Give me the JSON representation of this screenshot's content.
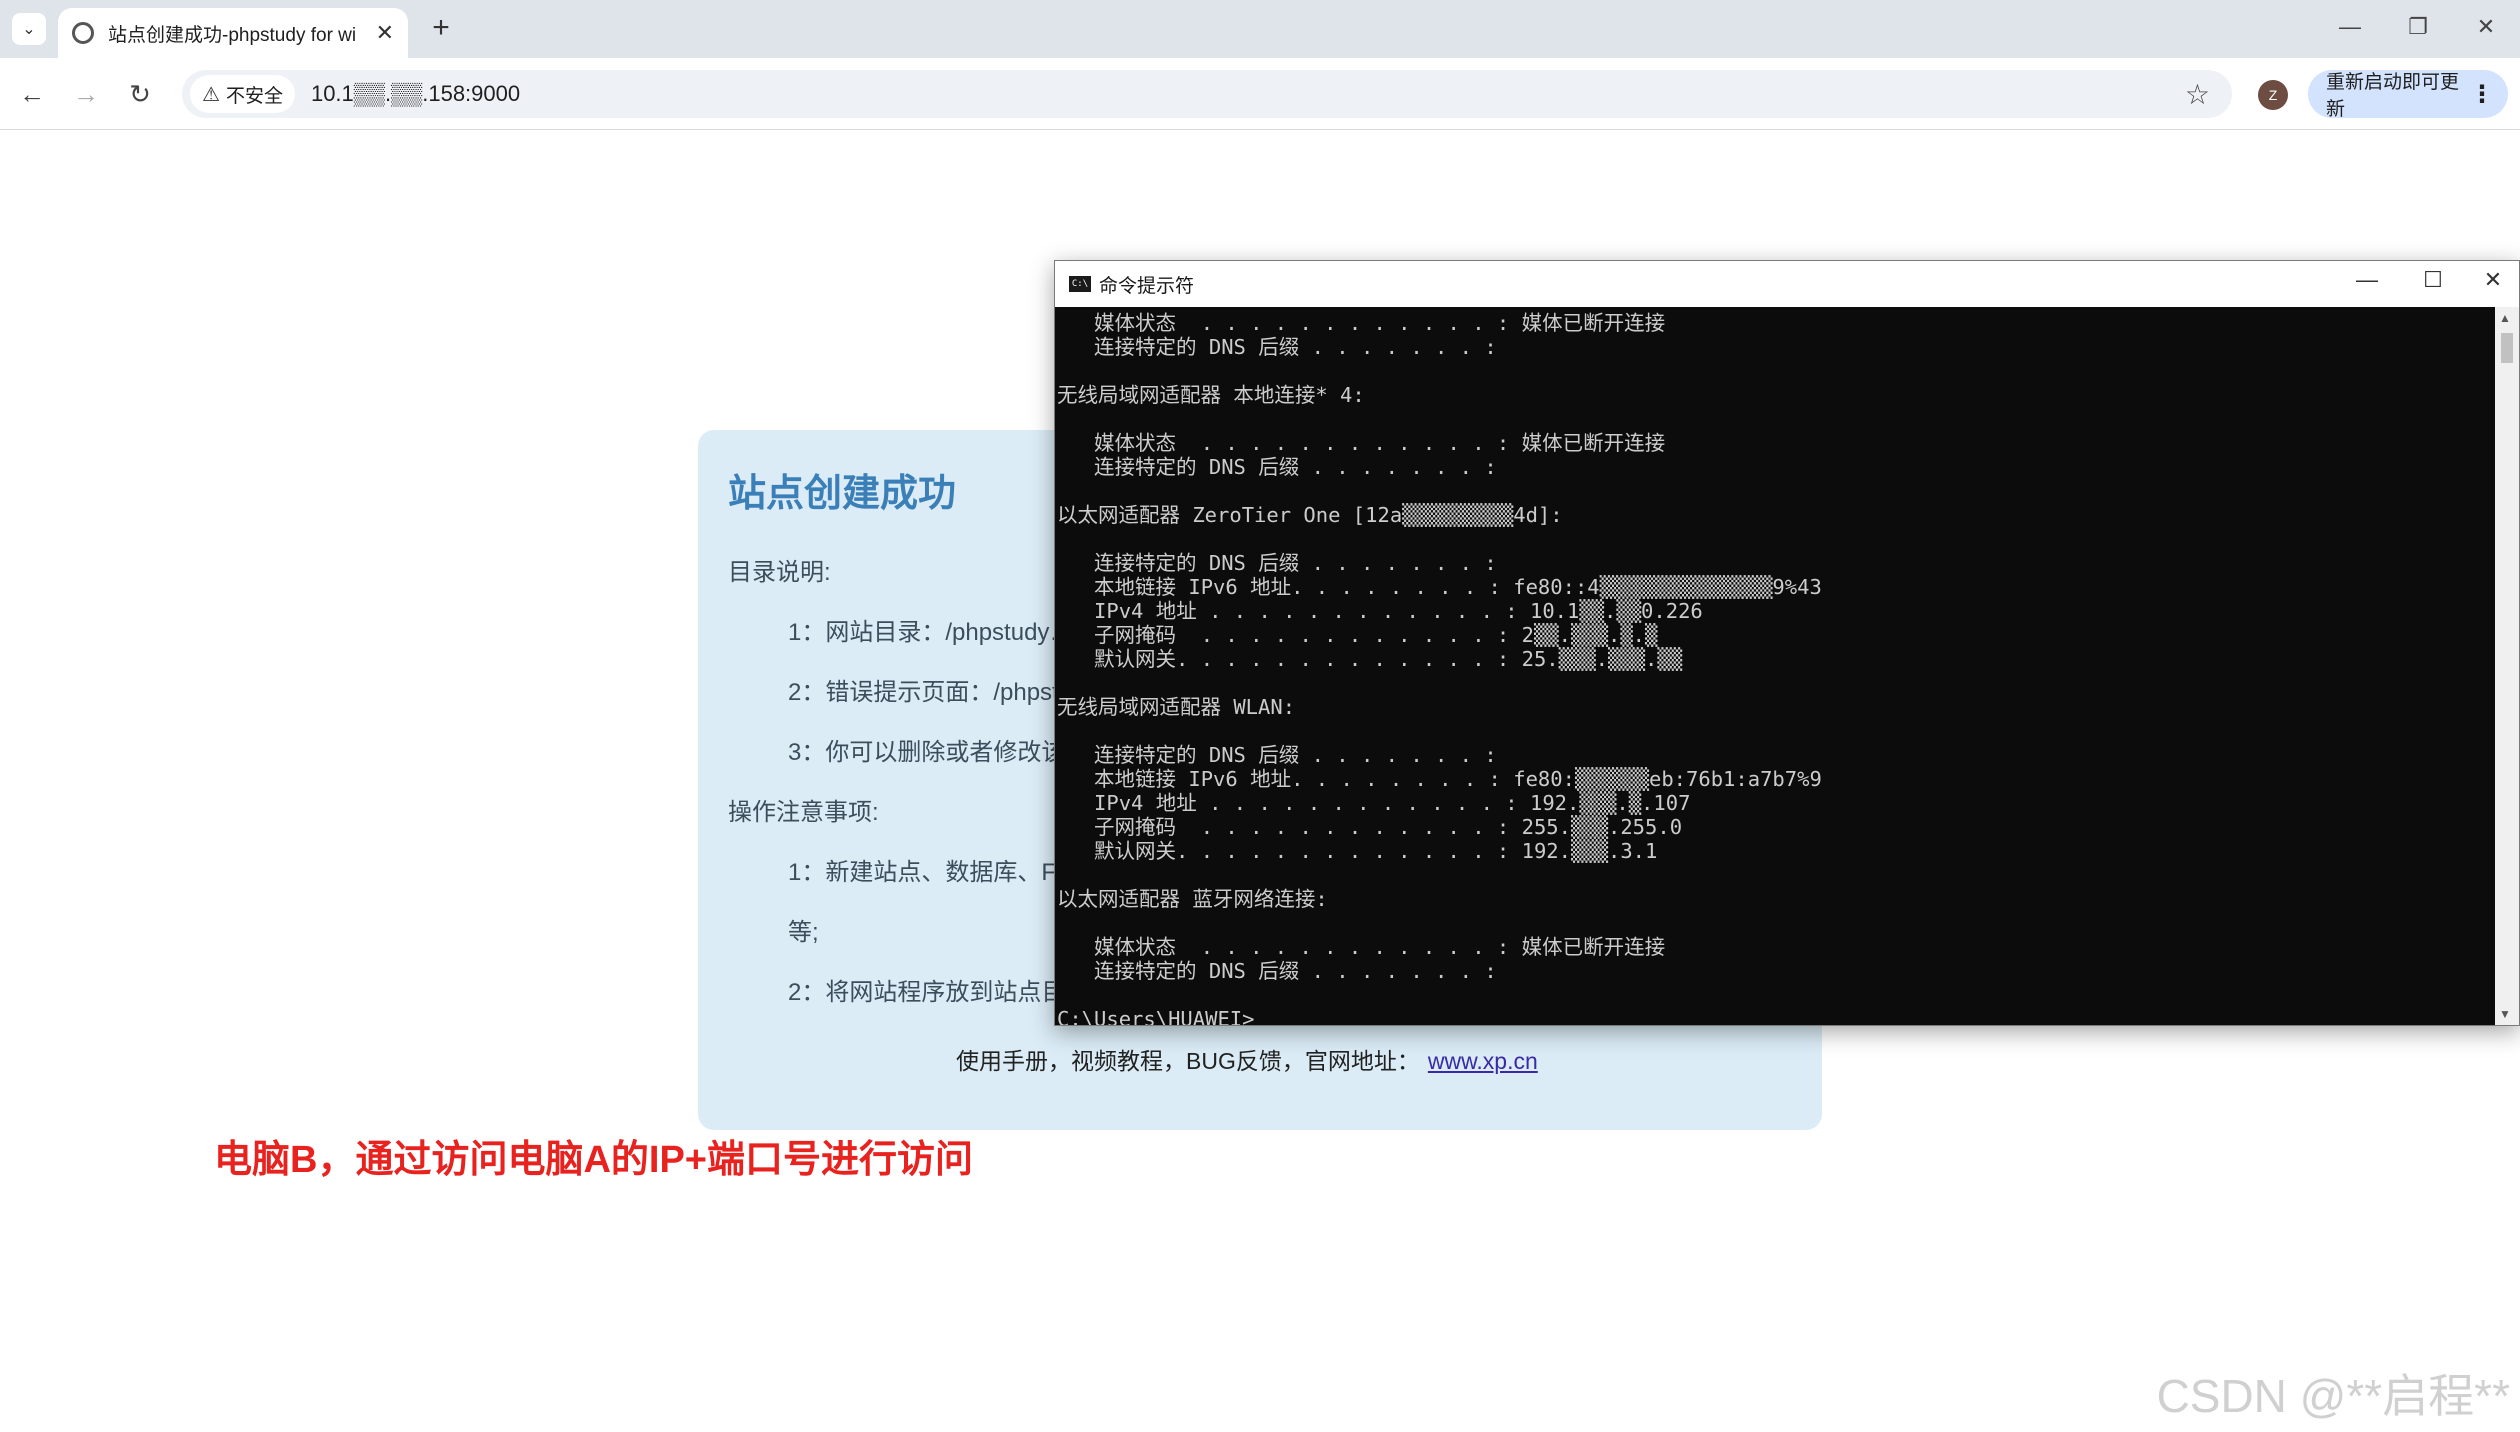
{
  "browser": {
    "tab_title": "站点创建成功-phpstudy for wi",
    "address": "10.1▒▒.▒▒.158:9000",
    "security_label": "不安全",
    "update_button": "重新启动即可更新",
    "avatar_letter": "Z"
  },
  "page": {
    "title": "站点创建成功",
    "lines": [
      "目录说明:",
      "1：网站目录：/phpstudy…",
      "2：错误提示页面：/phpst…",
      "3：你可以删除或者修改该…",
      "操作注意事项:",
      "1：新建站点、数据库、F…",
      "等;",
      "2：将网站程序放到站点目…"
    ],
    "footer_text": "使用手册，视频教程，BUG反馈，官网地址：",
    "footer_link": "www.xp.cn"
  },
  "annotation": "电脑B，通过访问电脑A的IP+端口号进行访问",
  "watermark": "CSDN @**启程**",
  "cmd": {
    "title": "命令提示符",
    "lines": [
      "   媒体状态  . . . . . . . . . . . . : 媒体已断开连接",
      "   连接特定的 DNS 后缀 . . . . . . . :",
      "",
      "无线局域网适配器 本地连接* 4:",
      "",
      "   媒体状态  . . . . . . . . . . . . : 媒体已断开连接",
      "   连接特定的 DNS 后缀 . . . . . . . :",
      "",
      "以太网适配器 ZeroTier One [12a▒▒▒▒▒▒▒▒▒4d]:",
      "",
      "   连接特定的 DNS 后缀 . . . . . . . :",
      "   本地链接 IPv6 地址. . . . . . . . : fe80::4▒▒▒▒▒▒▒▒▒▒▒▒▒▒9%43",
      "   IPv4 地址 . . . . . . . . . . . . : 10.1▒▒.▒▒0.226",
      "   子网掩码  . . . . . . . . . . . . : 2▒▒.▒▒▒.▒.▒",
      "   默认网关. . . . . . . . . . . . . : 25.▒▒▒.▒▒▒.▒▒",
      "",
      "无线局域网适配器 WLAN:",
      "",
      "   连接特定的 DNS 后缀 . . . . . . . :",
      "   本地链接 IPv6 地址. . . . . . . . : fe80:▒▒▒▒▒▒eb:76b1:a7b7%9",
      "   IPv4 地址 . . . . . . . . . . . . : 192.▒▒▒.▒.107",
      "   子网掩码  . . . . . . . . . . . . : 255.▒▒▒.255.0",
      "   默认网关. . . . . . . . . . . . . : 192.▒▒▒.3.1",
      "",
      "以太网适配器 蓝牙网络连接:",
      "",
      "   媒体状态  . . . . . . . . . . . . : 媒体已断开连接",
      "   连接特定的 DNS 后缀 . . . . . . . :",
      "",
      "C:\\Users\\HUAWEI>"
    ]
  }
}
